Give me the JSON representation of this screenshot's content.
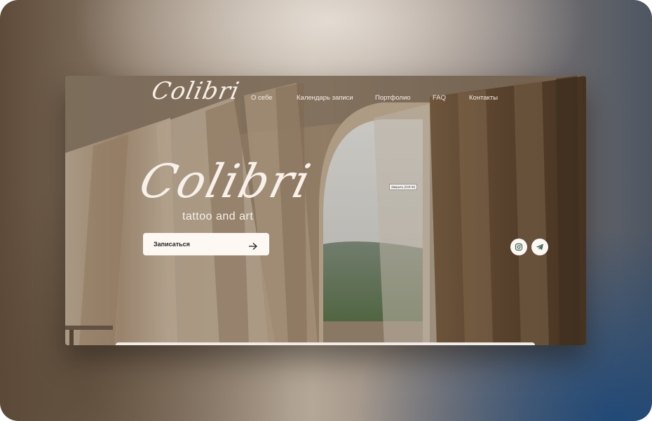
{
  "brand": {
    "logo_text": "Colibri"
  },
  "nav": {
    "items": [
      {
        "label": "О себе"
      },
      {
        "label": "Календарь записи"
      },
      {
        "label": "Портфолио"
      },
      {
        "label": "FAQ"
      },
      {
        "label": "Контакты"
      }
    ]
  },
  "hero": {
    "title": "Colibri",
    "subtitle": "tattoo and art",
    "cta_label": "Записаться",
    "tooltip": "Закрыть (Ctrl+E)"
  },
  "social": {
    "icons": [
      "instagram-icon",
      "telegram-icon"
    ]
  },
  "colors": {
    "accent_green": "#3c6b57",
    "button_bg": "#fdf8f3"
  }
}
